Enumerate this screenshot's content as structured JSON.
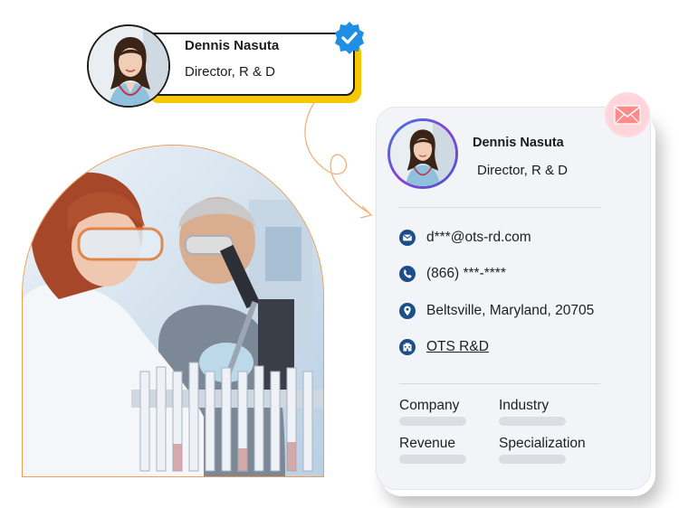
{
  "badge": {
    "name": "Dennis Nasuta",
    "title": "Director, R & D"
  },
  "card": {
    "name": "Dennis Nasuta",
    "title": "Director, R & D",
    "email": "d***@ots-rd.com",
    "phone": "(866) ***-****",
    "location": "Beltsville, Maryland, 20705",
    "company_link": "OTS R&D",
    "fields": [
      "Company",
      "Industry",
      "Revenue",
      "Specialization"
    ]
  },
  "colors": {
    "accent_yellow": "#f6c800",
    "verified_blue": "#1f8fe5",
    "icon_navy": "#1d4e8a",
    "photo_border": "#ef9f55",
    "mail_pink": "#ffd4da"
  },
  "icons": [
    "verified-icon",
    "email-icon",
    "phone-icon",
    "location-icon",
    "company-icon",
    "mail-icon"
  ]
}
